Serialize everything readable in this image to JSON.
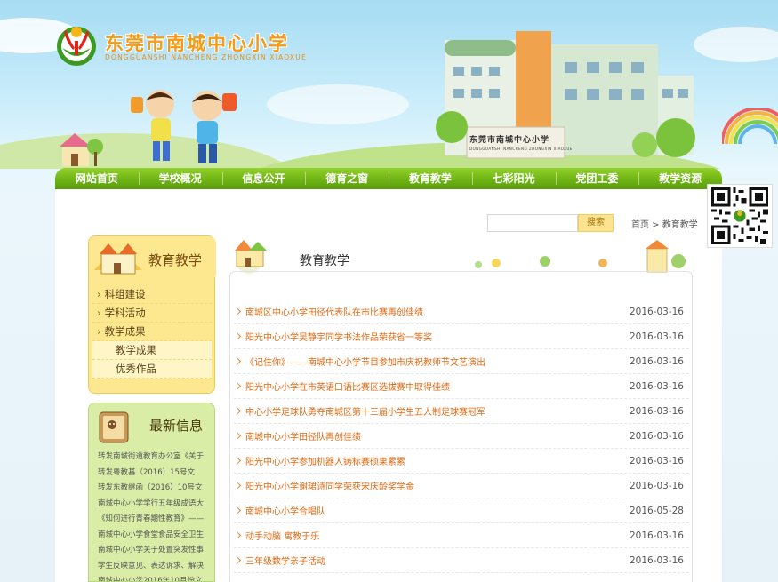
{
  "header": {
    "school_name": "东莞市南城中心小学",
    "school_pinyin": "DONGGUANSHI NANCHENG ZHONGXIN XIAOXUE",
    "building_sign": "东莞市南城中心小学",
    "building_sign_pinyin": "DONGGUANSHI NANCHENG ZHONGXIN XIAOXUE"
  },
  "nav": {
    "items": [
      {
        "label": "网站首页"
      },
      {
        "label": "学校概况"
      },
      {
        "label": "信息公开"
      },
      {
        "label": "德育之窗"
      },
      {
        "label": "教育教学"
      },
      {
        "label": "七彩阳光"
      },
      {
        "label": "党团工委"
      },
      {
        "label": "教学资源"
      }
    ]
  },
  "search": {
    "placeholder": "",
    "button_label": "搜索"
  },
  "breadcrumb": "首页 > 教育教学",
  "sidebar": {
    "title": "教育教学",
    "items": [
      {
        "label": "科组建设"
      },
      {
        "label": "学科活动"
      },
      {
        "label": "教学成果"
      }
    ],
    "sub_items": [
      {
        "label": "教学成果"
      },
      {
        "label": "优秀作品"
      }
    ]
  },
  "latest_news": {
    "title": "最新信息",
    "lines": [
      "转发南城街道教育办公室《关于",
      "转发粤教基（2016）15号文",
      "转发东教继函（2016）10号文",
      "南城中心小学学行五年级成语大",
      "《知何进行青春期性教育》——",
      "南城中心小学食堂食品安全卫生",
      "南城中心小学关于处置突发性事",
      "学生反映意见、表达诉求、解决",
      "南城中心小学2016年10月份文"
    ]
  },
  "content": {
    "title": "教育教学",
    "articles": [
      {
        "title": "南城区中心小学田径代表队在市比赛再创佳绩",
        "date": "2016-03-16"
      },
      {
        "title": "阳光中心小学吴静宇同学书法作品荣获省一等奖",
        "date": "2016-03-16"
      },
      {
        "title": "《记住你》——南城中心小学节目参加市庆祝教师节文艺演出",
        "date": "2016-03-16"
      },
      {
        "title": "阳光中心小学在市英语口语比赛区选拔赛中取得佳绩",
        "date": "2016-03-16"
      },
      {
        "title": "中心小学足球队勇夺南城区第十三届小学生五人制足球赛冠军",
        "date": "2016-03-16"
      },
      {
        "title": "南城中心小学田径队再创佳绩",
        "date": "2016-03-16"
      },
      {
        "title": "阳光中心小学参加机器人铸标赛硕果累累",
        "date": "2016-03-16"
      },
      {
        "title": "阳光中心小学谢珺诗同学荣获宋庆龄奖学金",
        "date": "2016-03-16"
      },
      {
        "title": "南城中心小学合唱队",
        "date": "2016-05-28"
      },
      {
        "title": "动手动脑 寓教于乐",
        "date": "2016-03-16"
      },
      {
        "title": "三年级数学亲子活动",
        "date": "2016-03-16"
      }
    ]
  },
  "colors": {
    "nav_green": "#6fb415",
    "title_orange": "#f49a16",
    "link_orange": "#e16a12",
    "sidebar_yellow": "#fde88f",
    "news_green": "#d9eda6"
  }
}
